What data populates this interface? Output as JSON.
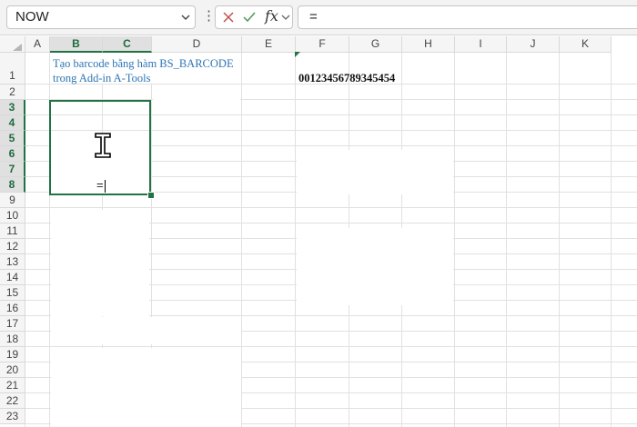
{
  "formula_bar": {
    "name_box": "NOW",
    "fx_label": "fx",
    "formula": "="
  },
  "columns": [
    "A",
    "B",
    "C",
    "D",
    "E",
    "F",
    "G",
    "H",
    "I",
    "J",
    "K"
  ],
  "rows": [
    "1",
    "2",
    "3",
    "4",
    "5",
    "6",
    "7",
    "8",
    "9",
    "10",
    "11",
    "12",
    "13",
    "14",
    "15",
    "16",
    "17",
    "18",
    "19",
    "20",
    "21",
    "22",
    "23"
  ],
  "cells": {
    "B1_line1": "Tạo barcode bằng hàm BS_BARCODE",
    "B1_line2": "trong Add-in A-Tools",
    "F1": "00123456789345454",
    "editing_value": "="
  },
  "colors": {
    "accent": "#217346",
    "note_text": "#2e75b6"
  }
}
